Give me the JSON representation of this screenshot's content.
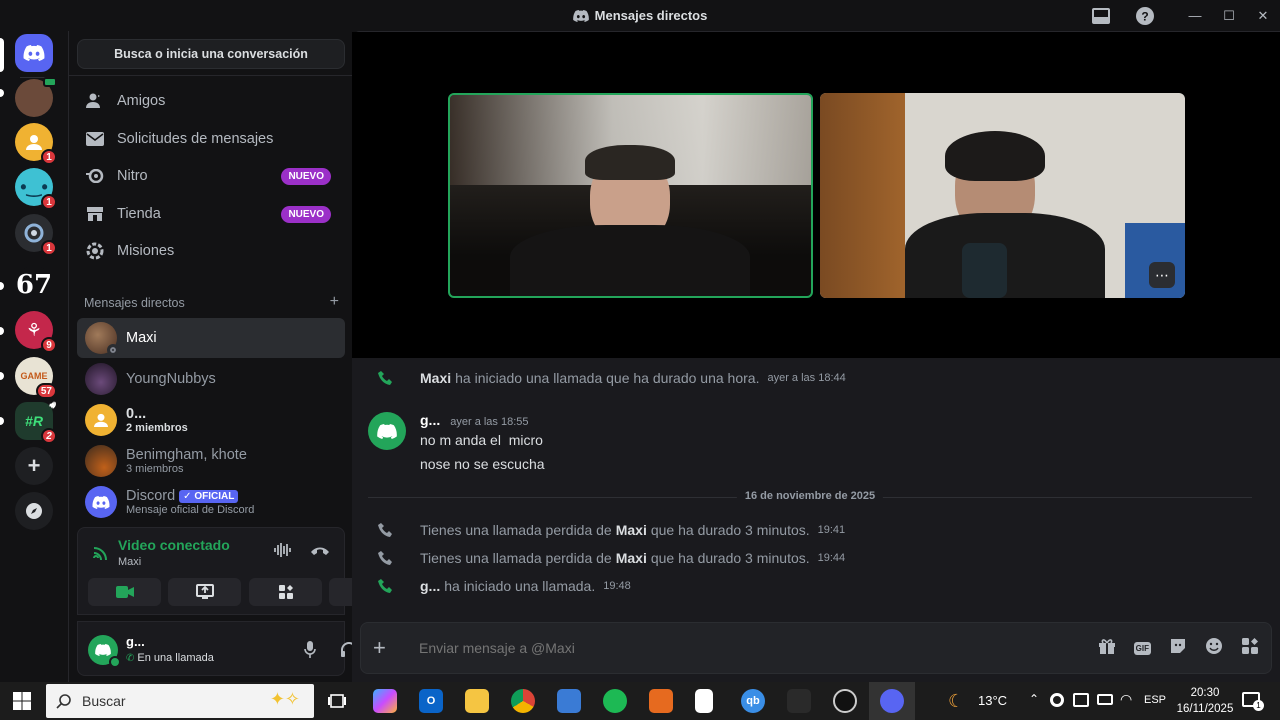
{
  "window": {
    "title": "Mensajes directos",
    "controls": [
      "—",
      "☐",
      "✕"
    ]
  },
  "rail": {
    "servers": [
      {
        "label": "",
        "badge": "",
        "color": "#5865f2",
        "icon": "discord-logo"
      },
      {
        "label": "",
        "badge": "",
        "color": "#6b4a3a",
        "icon": "avatar"
      },
      {
        "label": "",
        "badge": "1",
        "color": "#f0b232",
        "icon": "group-icon"
      },
      {
        "label": "",
        "badge": "1",
        "color": "#3ec1d3",
        "icon": "emoji-icon"
      },
      {
        "label": "",
        "badge": "1",
        "color": "#2b2d31",
        "icon": "spiral-icon"
      },
      {
        "label": "67",
        "badge": "",
        "color": "#121214",
        "icon": "text"
      },
      {
        "label": "",
        "badge": "9",
        "color": "#c4274b",
        "icon": "art-icon"
      },
      {
        "label": "",
        "badge": "57",
        "color": "#e8e3d4",
        "icon": "game-icon"
      },
      {
        "label": "#R",
        "badge": "2",
        "color": "#1f3b2d",
        "icon": "text"
      }
    ]
  },
  "sidebar": {
    "search_label": "Busca o inicia una conversación",
    "nav": [
      {
        "label": "Amigos",
        "badge": "",
        "icon": "friends-icon"
      },
      {
        "label": "Solicitudes de mensajes",
        "badge": "",
        "icon": "mail-icon"
      },
      {
        "label": "Nitro",
        "badge": "NUEVO",
        "icon": "nitro-icon"
      },
      {
        "label": "Tienda",
        "badge": "NUEVO",
        "icon": "shop-icon"
      },
      {
        "label": "Misiones",
        "badge": "",
        "icon": "quests-icon"
      }
    ],
    "dm_header": "Mensajes directos",
    "dm_add": "+",
    "dms": [
      {
        "name": "Maxi",
        "sub": "",
        "color": "#6b4a3a"
      },
      {
        "name": "YoungNubbys",
        "sub": "",
        "color": "#5a3a6b"
      },
      {
        "name": "0...",
        "sub": "2 miembros",
        "color": "#f0b232"
      },
      {
        "name": "Benimgham, khote",
        "sub": "3 miembros",
        "color": "#8a5a3a"
      },
      {
        "name": "Discord",
        "sub": "Mensaje oficial de Discord",
        "color": "#5865f2",
        "tag": "✓ OFICIAL"
      }
    ],
    "voice": {
      "status": "Video conectado",
      "channel": "Maxi"
    },
    "user": {
      "name": "g...",
      "status": "En una llamada"
    }
  },
  "messages": {
    "call1": {
      "user": "Maxi",
      "text": "ha iniciado una llamada que ha durado una hora.",
      "time": "ayer a las 18:44"
    },
    "msg": {
      "author": "g...",
      "time": "ayer a las 18:55",
      "lines": [
        "no m anda el  micro",
        "nose no se escucha"
      ]
    },
    "divider": "16 de noviembre de 2025",
    "missed1": {
      "pre": "Tienes una llamada perdida de",
      "user": "Maxi",
      "post": "que ha durado 3 minutos.",
      "time": "19:41"
    },
    "missed2": {
      "pre": "Tienes una llamada perdida de",
      "user": "Maxi",
      "post": "que ha durado 3 minutos.",
      "time": "19:44"
    },
    "call2": {
      "user": "g...",
      "text": "ha iniciado una llamada.",
      "time": "19:48"
    }
  },
  "composer": {
    "placeholder": "Enviar mensaje a @Maxi"
  },
  "taskbar": {
    "search": "Buscar",
    "weather": "13°C",
    "lang": "ESP",
    "time": "20:30",
    "date": "16/11/2025",
    "notif": "1"
  },
  "colors": {
    "accent": "#5865f2",
    "green": "#23a55a",
    "nuevo": "#9b30c8"
  }
}
